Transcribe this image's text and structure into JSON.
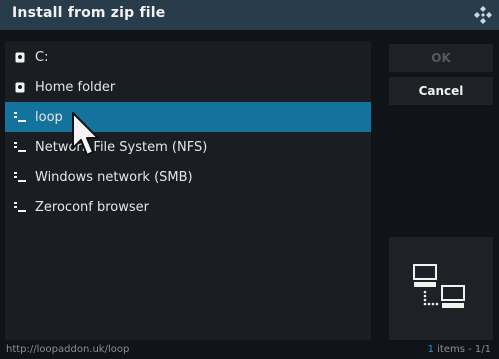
{
  "dialog": {
    "title": "Install from zip file",
    "logo_icon": "kodi-logo-icon"
  },
  "list": {
    "items": [
      {
        "label": "C:",
        "icon": "drive-icon",
        "selected": false
      },
      {
        "label": "Home folder",
        "icon": "drive-icon",
        "selected": false
      },
      {
        "label": "loop",
        "icon": "network-share-icon",
        "selected": true
      },
      {
        "label": "Network File System (NFS)",
        "icon": "network-share-icon",
        "selected": false
      },
      {
        "label": "Windows network (SMB)",
        "icon": "network-share-icon",
        "selected": false
      },
      {
        "label": "Zeroconf browser",
        "icon": "network-share-icon",
        "selected": false
      }
    ]
  },
  "buttons": {
    "ok_label": "OK",
    "cancel_label": "Cancel"
  },
  "preview": {
    "icon": "network-computers-icon"
  },
  "footer": {
    "path": "http://loopaddon.uk/loop",
    "count": "1",
    "items_text": " items - 1/1"
  },
  "colors": {
    "accent": "#14739c",
    "titlebar": "#293c4c",
    "background": "#101419"
  }
}
